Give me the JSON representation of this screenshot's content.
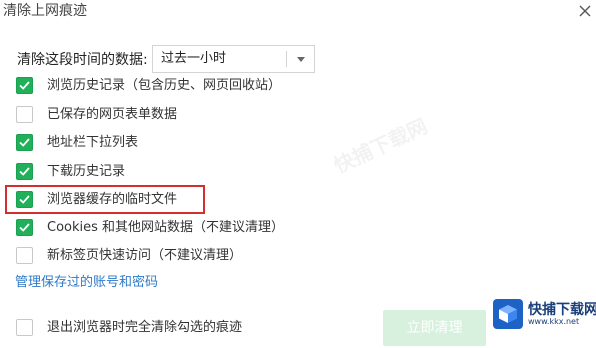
{
  "dialog": {
    "title": "清除上网痕迹",
    "close_icon": "close-icon"
  },
  "time_range": {
    "label": "清除这段时间的数据:",
    "selected": "过去一小时"
  },
  "options": [
    {
      "label": "浏览历史记录（包含历史、网页回收站）",
      "checked": true
    },
    {
      "label": "已保存的网页表单数据",
      "checked": false
    },
    {
      "label": "地址栏下拉列表",
      "checked": true
    },
    {
      "label": "下载历史记录",
      "checked": true
    },
    {
      "label": "浏览器缓存的临时文件",
      "checked": true
    },
    {
      "label": "Cookies 和其他网站数据（不建议清理）",
      "checked": true
    },
    {
      "label": "新标签页快速访问（不建议清理）",
      "checked": false
    }
  ],
  "manage_link": "管理保存过的账号和密码",
  "exit_option": {
    "label": "退出浏览器时完全清除勾选的痕迹",
    "checked": false
  },
  "clear_button": "立即清理",
  "watermark": "快捕下载网",
  "logo": {
    "name": "快捕下载网",
    "url": "www.kkx.net"
  },
  "colors": {
    "checked": "#20b05a",
    "highlight": "#d42f2f",
    "link": "#2f7ac8",
    "button_bg": "#d8f0de"
  }
}
